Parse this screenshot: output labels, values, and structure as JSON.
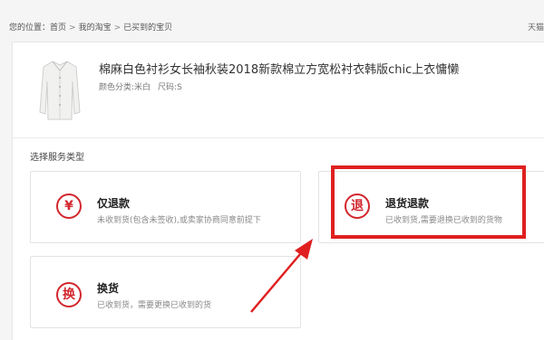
{
  "breadcrumb": {
    "prefix": "您的位置：",
    "items": [
      "首页",
      "我的淘宝",
      "已买到的宝贝"
    ],
    "separator": ">"
  },
  "header_right": "天猫",
  "product": {
    "title": "棉麻白色衬衫女长袖秋装2018新款棉立方宽松衬衣韩版chic上衣慵懒",
    "color_label": "颜色分类:米白",
    "size_label": "尺码:S"
  },
  "section_title": "选择服务类型",
  "options": [
    {
      "glyph": "¥",
      "title": "仅退款",
      "desc": "未收到货(包含未签收),或卖家协商同意前提下"
    },
    {
      "glyph": "退",
      "title": "退货退款",
      "desc": "已收到货,需要退换已收到的货物"
    },
    {
      "glyph": "换",
      "title": "换货",
      "desc": "已收到货，需要更换已收到的货"
    }
  ],
  "icons": {
    "refund": "yen-return-icon",
    "return": "return-icon",
    "exchange": "exchange-icon"
  },
  "colors": {
    "accent": "#d2272e",
    "highlight": "#e02020"
  }
}
